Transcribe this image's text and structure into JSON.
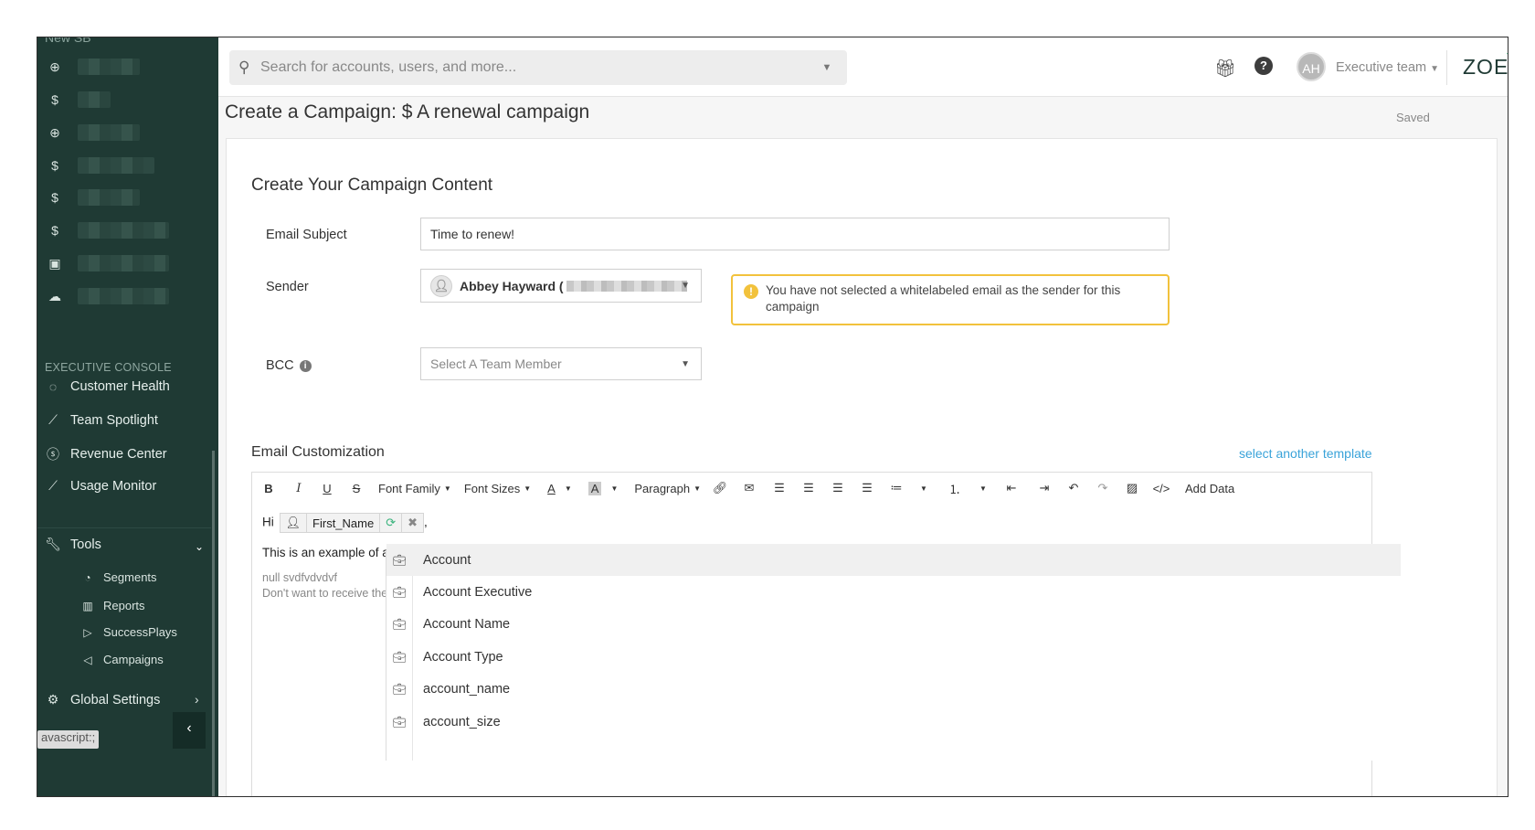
{
  "sidebar": {
    "top_cut_label": "New SB",
    "account_rows": [
      {
        "icon": "globe-icon",
        "glyph": "⊕"
      },
      {
        "icon": "dollar-icon",
        "glyph": "$"
      },
      {
        "icon": "globe-icon",
        "glyph": "⊕"
      },
      {
        "icon": "dollar-icon",
        "glyph": "$"
      },
      {
        "icon": "dollar-icon",
        "glyph": "$"
      },
      {
        "icon": "dollar-icon",
        "glyph": "$"
      },
      {
        "icon": "money-icon",
        "glyph": "▣"
      },
      {
        "icon": "cloud-icon",
        "glyph": "☁"
      }
    ],
    "section_label": "EXECUTIVE CONSOLE",
    "nav": [
      {
        "label": "Customer Health",
        "icon": "heart-icon",
        "glyph": "◌"
      },
      {
        "label": "Team Spotlight",
        "icon": "spotlight-icon",
        "glyph": "⟋"
      },
      {
        "label": "Revenue Center",
        "icon": "revenue-icon",
        "glyph": "⓿"
      },
      {
        "label": "Usage Monitor",
        "icon": "chart-line-icon",
        "glyph": "⟋"
      }
    ],
    "tools_label": "Tools",
    "tools_sub": [
      {
        "label": "Segments",
        "icon": "pie-icon",
        "glyph": "◔"
      },
      {
        "label": "Reports",
        "icon": "bar-chart-icon",
        "glyph": "▥"
      },
      {
        "label": "SuccessPlays",
        "icon": "play-icon",
        "glyph": "▷"
      },
      {
        "label": "Campaigns",
        "icon": "megaphone-icon",
        "glyph": "◁"
      }
    ],
    "global_settings_label": "Global Settings",
    "collapse_glyph": "‹",
    "status_bar_text": "avascript:;"
  },
  "header": {
    "search_placeholder": "Search for accounts, users, and more...",
    "avatar_initials": "AH",
    "team_label": "Executive team",
    "logo_text": "ZOE"
  },
  "page": {
    "title": "Create a Campaign: $ A renewal campaign",
    "saved_label": "Saved",
    "content_title": "Create Your Campaign Content",
    "email_subject_label": "Email Subject",
    "email_subject_value": "Time to renew!",
    "sender_label": "Sender",
    "sender_name": "Abbey Hayward (",
    "warning_text": "You have not selected a whitelabeled email as the sender for this campaign",
    "bcc_label": "BCC",
    "bcc_placeholder": "Select A Team Member",
    "customization_title": "Email Customization",
    "template_link": "select another template"
  },
  "editor": {
    "toolbar": {
      "bold": "B",
      "italic": "I",
      "underline": "U",
      "strike": "S",
      "font_family": "Font Family",
      "font_sizes": "Font Sizes",
      "text_color": "A",
      "bg_color": "A",
      "paragraph": "Paragraph",
      "add_data": "Add Data"
    },
    "greeting": "Hi",
    "token_name": "First_Name",
    "line2": "This is an example of an $",
    "muted1": "null svdfvdvdvf",
    "muted2": "Don't want to receive thes"
  },
  "dropdown": {
    "items": [
      "Account",
      "Account Executive",
      "Account Name",
      "Account Type",
      "account_name",
      "account_size"
    ]
  }
}
